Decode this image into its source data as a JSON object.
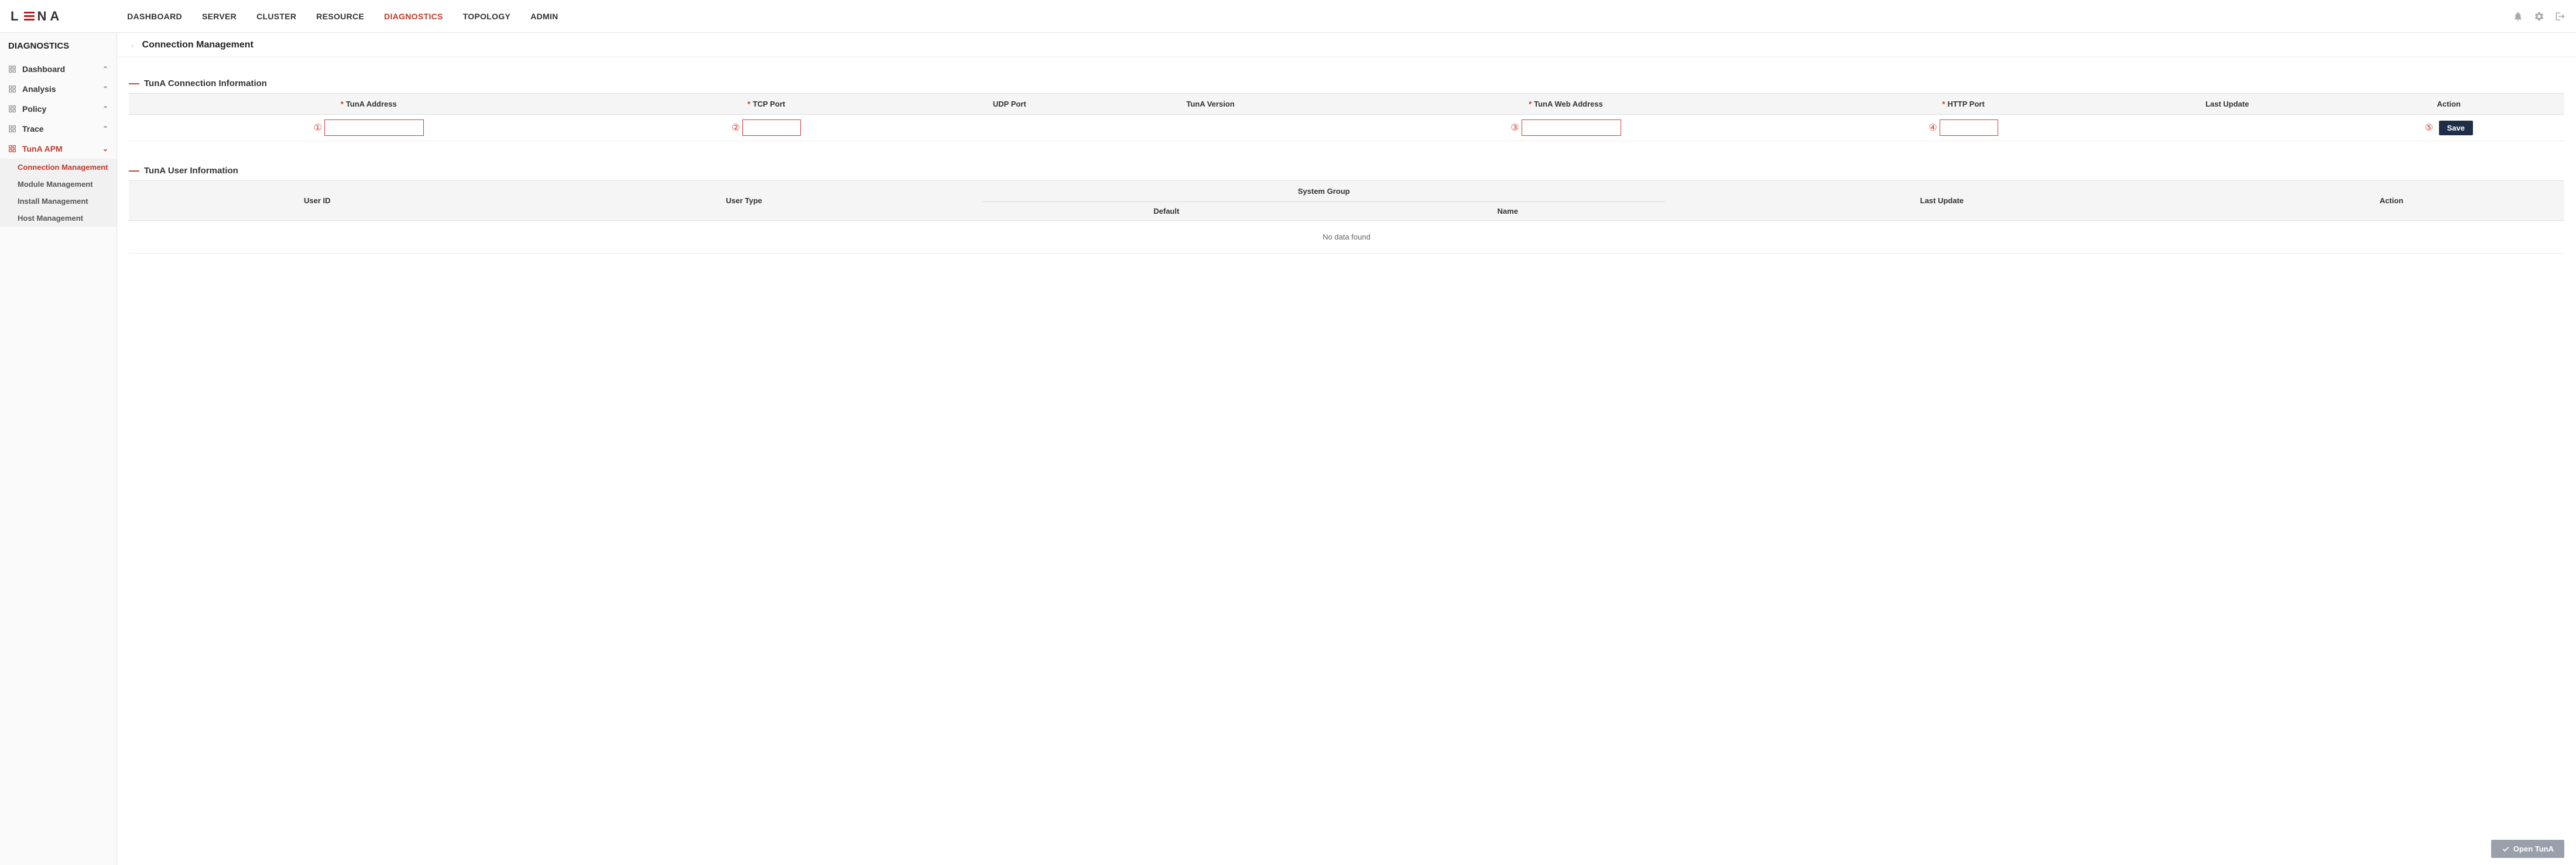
{
  "logo": {
    "text_left": "L",
    "text_right": "NA"
  },
  "nav": {
    "items": [
      "DASHBOARD",
      "SERVER",
      "CLUSTER",
      "RESOURCE",
      "DIAGNOSTICS",
      "TOPOLOGY",
      "ADMIN"
    ],
    "active": "DIAGNOSTICS"
  },
  "sidebar": {
    "title": "DIAGNOSTICS",
    "sections": [
      {
        "label": "Dashboard",
        "expanded": false
      },
      {
        "label": "Analysis",
        "expanded": false
      },
      {
        "label": "Policy",
        "expanded": false
      },
      {
        "label": "Trace",
        "expanded": false
      },
      {
        "label": "TunA APM",
        "expanded": true,
        "active": true,
        "sub": [
          {
            "label": "Connection Management",
            "active": true
          },
          {
            "label": "Module Management"
          },
          {
            "label": "Install Management"
          },
          {
            "label": "Host Management"
          }
        ]
      }
    ]
  },
  "breadcrumb": {
    "title": "Connection Management"
  },
  "conn_section": {
    "title": "TunA Connection Information",
    "headers": {
      "addr": "TunA Address",
      "tcp": "TCP Port",
      "udp": "UDP Port",
      "ver": "TunA Version",
      "web": "TunA Web Address",
      "http": "HTTP Port",
      "last": "Last Update",
      "action": "Action"
    },
    "annotations": {
      "a1": "①",
      "a2": "②",
      "a3": "③",
      "a4": "④",
      "a5": "⑤"
    },
    "save_label": "Save"
  },
  "user_section": {
    "title": "TunA User Information",
    "headers": {
      "userid": "User ID",
      "usertype": "User Type",
      "sysgroup": "System Group",
      "default": "Default",
      "name": "Name",
      "last": "Last Update",
      "action": "Action"
    },
    "no_data": "No data found"
  },
  "open_btn": "Open TunA"
}
